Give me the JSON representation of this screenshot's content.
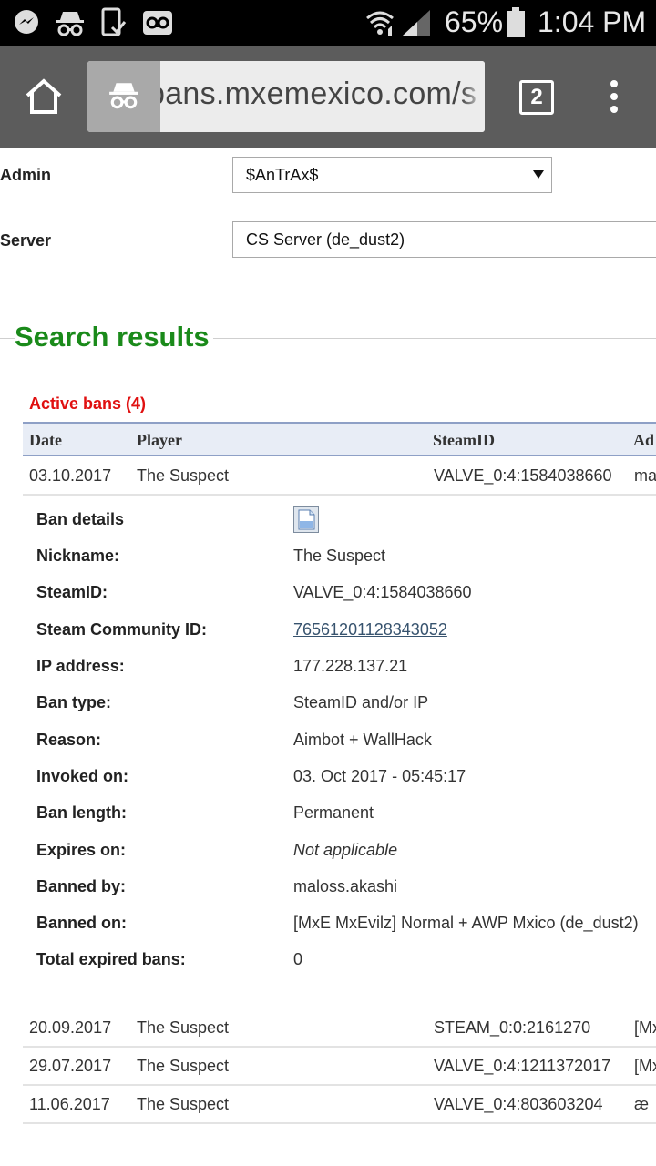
{
  "status_bar": {
    "battery_percent": "65%",
    "time": "1:04 PM",
    "icons": [
      "messenger-icon",
      "incognito-icon",
      "phone-check-icon",
      "voicemail-icon",
      "wifi-icon",
      "signal-icon",
      "battery-icon"
    ]
  },
  "browser": {
    "url": "bans.mxemexico.com/s",
    "tab_count": "2",
    "icons": [
      "home-icon",
      "incognito-icon",
      "menu-dots-icon"
    ]
  },
  "filters": {
    "admin_label": "Admin",
    "admin_value": "$AnTrAx$",
    "server_label": "Server",
    "server_value": "CS Server (de_dust2)"
  },
  "search_results_title": "Search results",
  "active_bans_title": "Active bans (4)",
  "table": {
    "headers": [
      "Date",
      "Player",
      "SteamID",
      "Ad"
    ],
    "rows": [
      {
        "date": "03.10.2017",
        "player": "The Suspect",
        "steamid": "VALVE_0:4:1584038660",
        "admin": "ma"
      },
      {
        "date": "20.09.2017",
        "player": "The Suspect",
        "steamid": "STEAM_0:0:2161270",
        "admin": "[Mx"
      },
      {
        "date": "29.07.2017",
        "player": "The Suspect",
        "steamid": "VALVE_0:4:1211372017",
        "admin": "[Mx"
      },
      {
        "date": "11.06.2017",
        "player": "The Suspect",
        "steamid": "VALVE_0:4:803603204",
        "admin": "æ"
      }
    ]
  },
  "ban_details": {
    "title": "Ban details",
    "rows": [
      {
        "label": "Nickname:",
        "value": "The Suspect"
      },
      {
        "label": "SteamID:",
        "value": "VALVE_0:4:1584038660"
      },
      {
        "label": "Steam Community ID:",
        "value": "76561201128343052"
      },
      {
        "label": "IP address:",
        "value": "177.228.137.21"
      },
      {
        "label": "Ban type:",
        "value": "SteamID and/or IP"
      },
      {
        "label": "Reason:",
        "value": "Aimbot + WallHack"
      },
      {
        "label": "Invoked on:",
        "value": "03. Oct 2017 - 05:45:17"
      },
      {
        "label": "Ban length:",
        "value": "Permanent"
      },
      {
        "label": "Expires on:",
        "value": "Not applicable"
      },
      {
        "label": "Banned by:",
        "value": "maloss.akashi"
      },
      {
        "label": "Banned on:",
        "value": "[MxE MxEvilz] Normal + AWP Mxico (de_dust2)"
      },
      {
        "label": "Total expired bans:",
        "value": "0"
      }
    ]
  },
  "colors": {
    "status_bar": "#000000",
    "toolbar": "#5c5c5c",
    "search_title": "#1a8a1a",
    "active_bans": "#e01010",
    "table_header_bg": "#e8edf6",
    "link": "#37536e"
  }
}
